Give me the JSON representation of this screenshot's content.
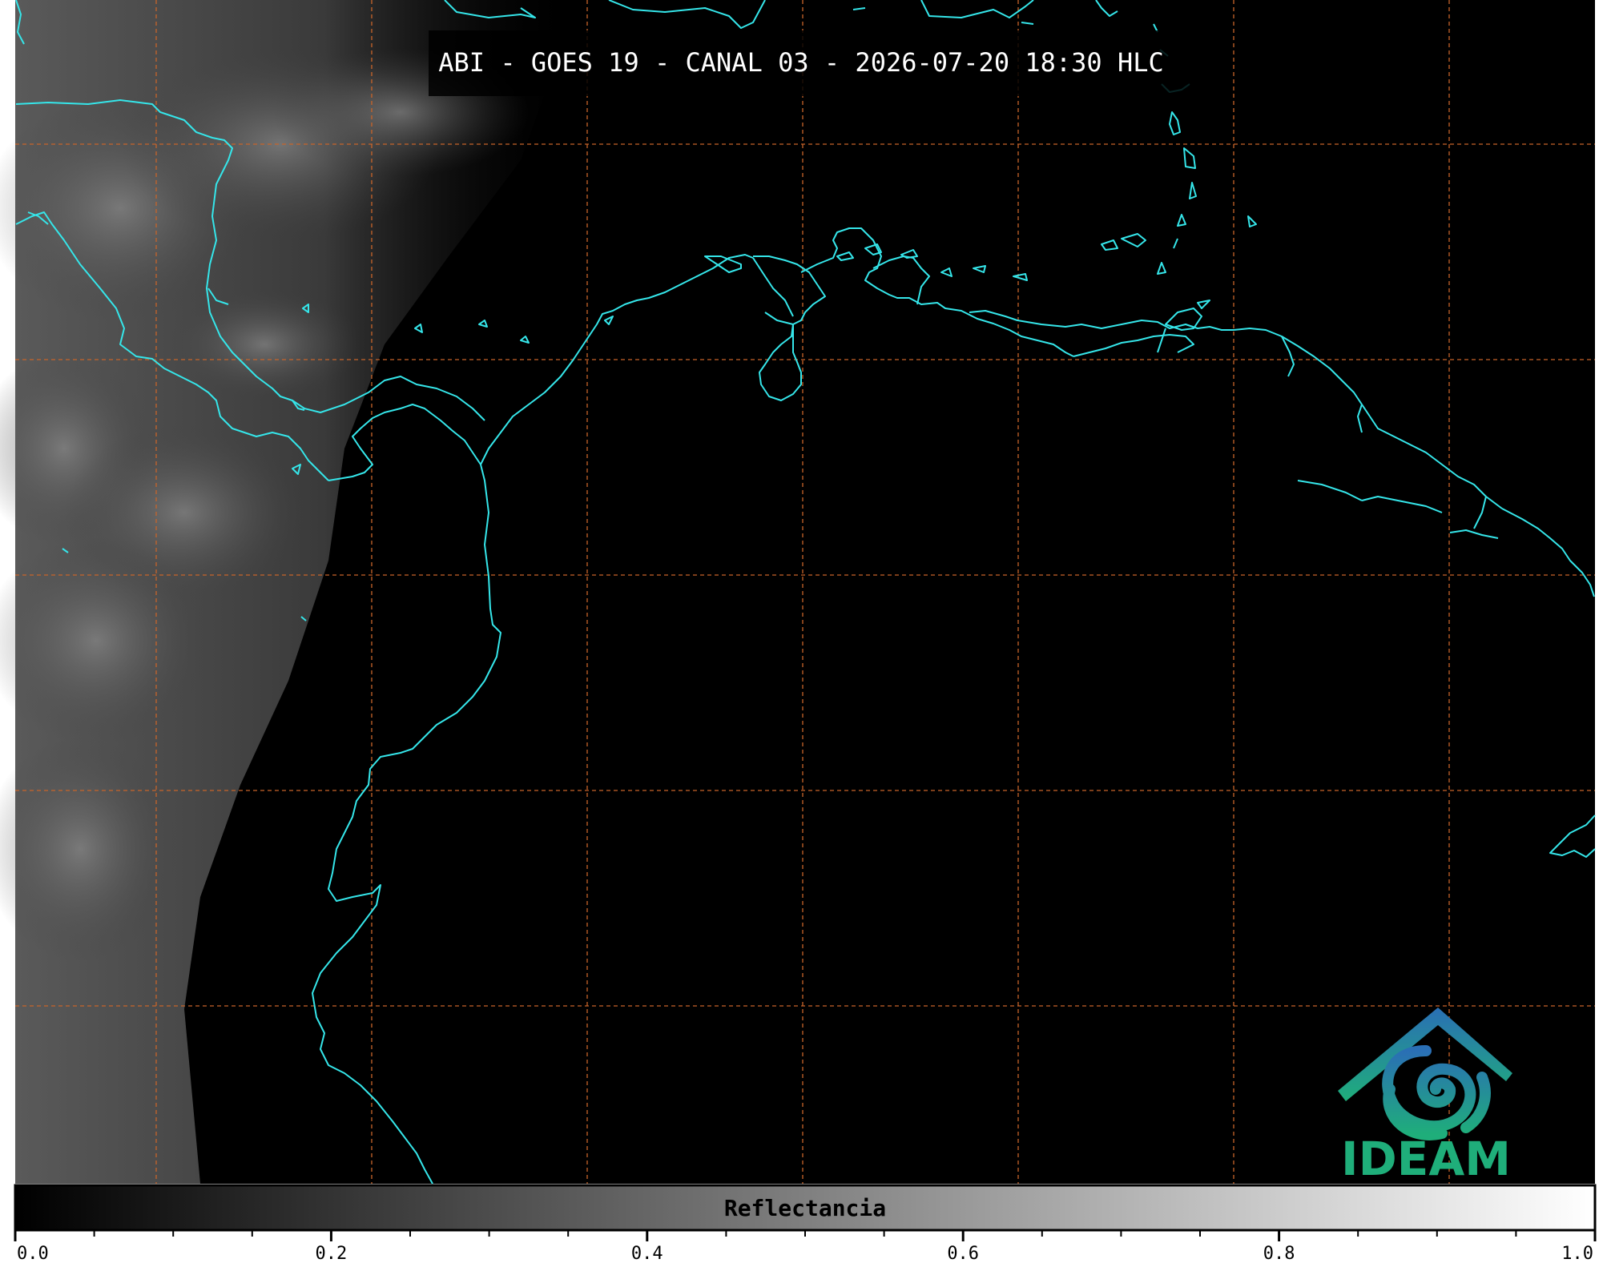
{
  "title": "ABI - GOES 19 - CANAL 03 - 2026-07-20 18:30 HLC",
  "colorbar": {
    "label": "Reflectancia",
    "min": 0.0,
    "max": 1.0,
    "tick_labels": [
      "0.0",
      "0.2",
      "0.4",
      "0.6",
      "0.8",
      "1.0"
    ],
    "major_ticks": [
      0.0,
      0.2,
      0.4,
      0.6,
      0.8,
      1.0
    ],
    "minor_ticks": [
      0.05,
      0.1,
      0.15,
      0.25,
      0.3,
      0.35,
      0.45,
      0.5,
      0.55,
      0.65,
      0.7,
      0.75,
      0.85,
      0.9,
      0.95
    ],
    "gradient": [
      "#000000",
      "#ffffff"
    ]
  },
  "logo": {
    "text": "IDEAM",
    "color_blue": "#2a6fb5",
    "color_green": "#1fae7a"
  },
  "colors": {
    "background": "#000000",
    "coastline": "#35e6ea",
    "graticule": "#c8642a"
  }
}
